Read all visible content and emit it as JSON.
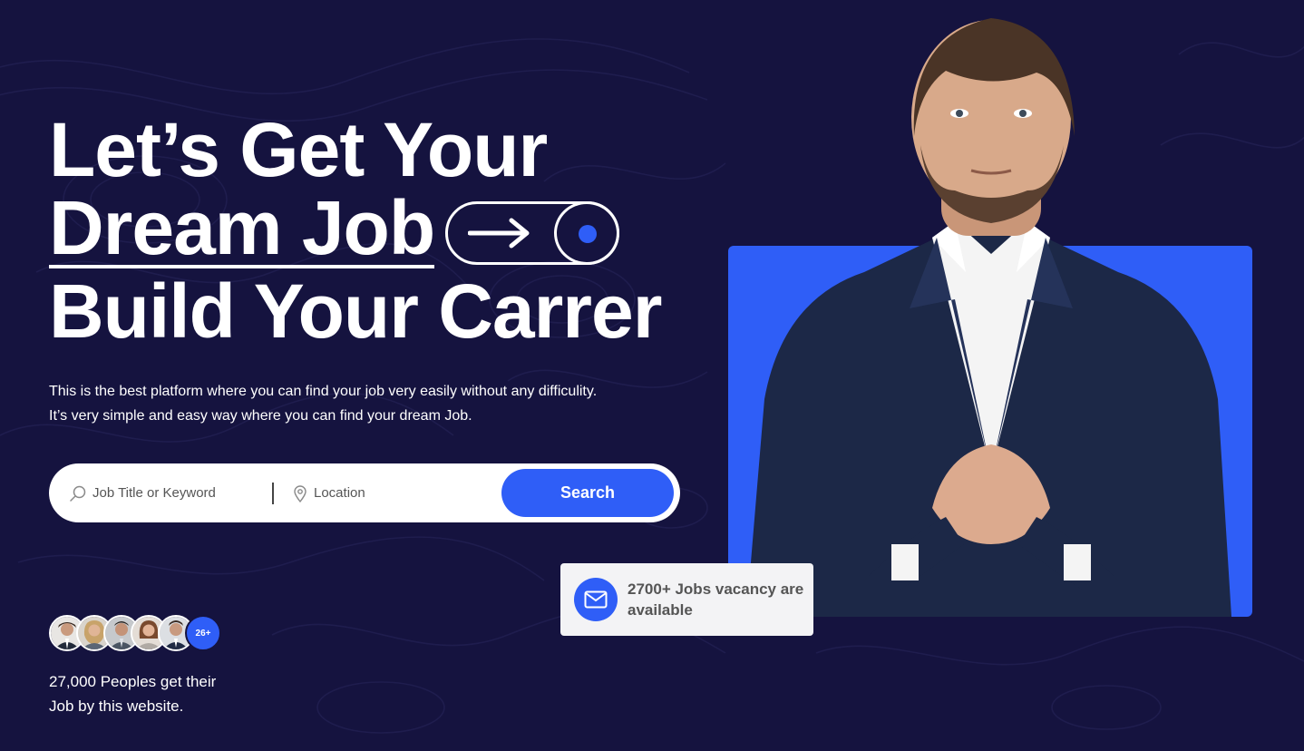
{
  "hero": {
    "line1": "Let’s Get Your",
    "line2": "Dream Job",
    "line3": "Build Your Carrer"
  },
  "description": {
    "line1": "This is the best platform where you can find your job very easily without any difficulity.",
    "line2": "It’s very simple and easy way where you can find your dream Job."
  },
  "search": {
    "keyword_placeholder": "Job Title or Keyword",
    "location_placeholder": "Location",
    "button_label": "Search"
  },
  "social_proof": {
    "avatar_count": "26+",
    "line1": "27,000 Peoples get their",
    "line2": "Job by this website."
  },
  "vacancy": {
    "text": "2700+ Jobs vacancy are available"
  },
  "colors": {
    "background": "#15133f",
    "accent": "#2f5ef7",
    "card": "#f3f3f5"
  }
}
